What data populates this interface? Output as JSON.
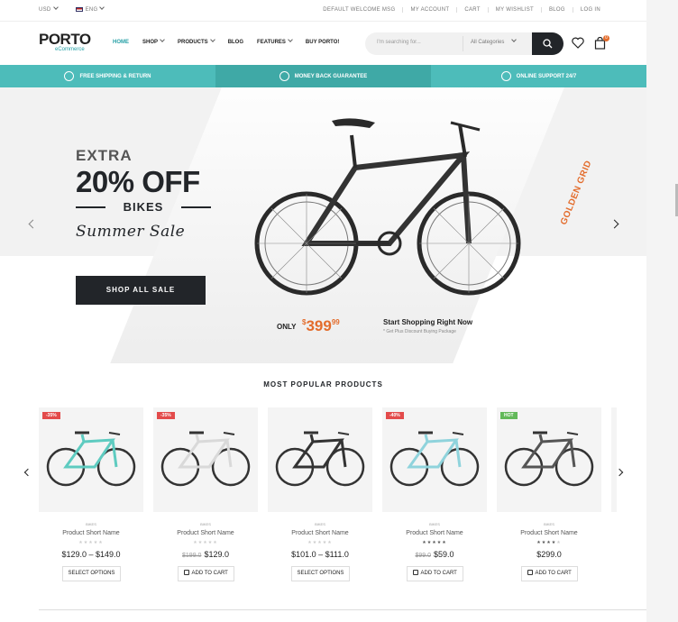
{
  "topbar": {
    "currency": "USD",
    "language": "ENG",
    "links": [
      "DEFAULT WELCOME MSG",
      "MY ACCOUNT",
      "CART",
      "MY WISHLIST",
      "BLOG",
      "LOG IN"
    ]
  },
  "header": {
    "logo": "PORTO",
    "logo_sub": "eCommerce",
    "nav": [
      "HOME",
      "SHOP",
      "PRODUCTS",
      "BLOG",
      "FEATURES",
      "BUY PORTO!"
    ],
    "search_placeholder": "I'm searching for...",
    "category_select": "All Categories",
    "cart_count": "0"
  },
  "infobar": [
    "FREE SHIPPING & RETURN",
    "MONEY BACK GUARANTEE",
    "ONLINE SUPPORT 24/7"
  ],
  "hero": {
    "extra": "EXTRA",
    "discount": "20% OFF",
    "product": "BIKES",
    "tagline": "Summer Sale",
    "button": "SHOP ALL SALE",
    "brand": "GOLDEN GRID",
    "only": "ONLY",
    "price_currency": "$",
    "price_main": "399",
    "price_cents": "99",
    "cta_title": "Start Shopping Right Now",
    "cta_sub": "* Get Plus Discount Buying Package"
  },
  "colors": {
    "accent": "#26a0a6",
    "orange": "#e36c2c",
    "dark": "#222529",
    "sale": "#e34b4b",
    "hot": "#62b959"
  },
  "products_title": "MOST POPULAR PRODUCTS",
  "products": [
    {
      "badge": "-35%",
      "badge_type": "sale",
      "frame": "#5ecbc0",
      "category": "BIKES",
      "name": "Product Short Name",
      "stars": 0,
      "price_old": "",
      "price": "$129.0 – $149.0",
      "button": "SELECT OPTIONS"
    },
    {
      "badge": "-35%",
      "badge_type": "sale",
      "frame": "#d9d9d9",
      "category": "BIKES",
      "name": "Product Short Name",
      "stars": 0,
      "price_old": "$199.0",
      "price": "$129.0",
      "button": "ADD TO CART"
    },
    {
      "badge": "",
      "badge_type": "",
      "frame": "#333333",
      "category": "BIKES",
      "name": "Product Short Name",
      "stars": 0,
      "price_old": "",
      "price": "$101.0 – $111.0",
      "button": "SELECT OPTIONS"
    },
    {
      "badge": "-40%",
      "badge_type": "sale",
      "frame": "#8fd3dc",
      "category": "BIKES",
      "name": "Product Short Name",
      "stars": 5,
      "price_old": "$99.0",
      "price": "$59.0",
      "button": "ADD TO CART"
    },
    {
      "badge": "HOT",
      "badge_type": "hot",
      "frame": "#555555",
      "category": "BIKES",
      "name": "Product Short Name",
      "stars": 4,
      "price_old": "",
      "price": "$299.0",
      "button": "ADD TO CART"
    }
  ]
}
